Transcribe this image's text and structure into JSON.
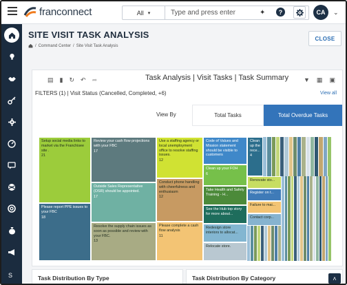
{
  "header": {
    "brand": "franconnect",
    "search": {
      "category": "All",
      "placeholder": "Type and press enter"
    },
    "user_initials": "CA"
  },
  "page": {
    "title": "SITE VISIT TASK ANALYSIS",
    "breadcrumbs": [
      "Command Center",
      "Site Visit Task Analysis"
    ],
    "close_label": "CLOSE"
  },
  "report": {
    "tabs": [
      "Task Analysis",
      "Visit Tasks",
      "Task Summary"
    ],
    "filters_label": "FILTERS (1)",
    "filter_name": "Visit Status",
    "filter_value": "(Cancelled, Completed, +6)",
    "view_all": "View all",
    "view_by": "View By",
    "toggle": [
      "Total Tasks",
      "Total Overdue Tasks"
    ],
    "active_toggle": "Total Overdue Tasks"
  },
  "treemap": {
    "tiles": [
      {
        "label": "Setup social media links to market via the Franchisee site .",
        "count": "21",
        "color": "#9ccc3b"
      },
      {
        "label": "Please report PPE issues to your FBC",
        "count": "18",
        "color": "#3c6d8a"
      },
      {
        "label": "Review your cash flow projections with your FBC",
        "count": "17",
        "color": "#5d7a7e"
      },
      {
        "label": "Outside Sales Representative (OSR) should be appointed.",
        "count": "17",
        "color": "#6fb1a3"
      },
      {
        "label": "Resolve the supply chain issues as soon as possible and review with your FBC.",
        "count": "13",
        "color": "#a8ab84"
      },
      {
        "label": "Use a staffing agency or local unemployment office to resolve staffing issues.",
        "count": "12",
        "color": "#d0e233"
      },
      {
        "label": "Conduct phone handling with cheerfulness and enthusiasm",
        "count": "12",
        "color": "#c79a62"
      },
      {
        "label": "Please complete a cash flow analysis",
        "count": "11",
        "color": "#f3c474"
      },
      {
        "label": "Code of Values and Mission statement should be visible to customers",
        "count": "",
        "color": "#3f88c9"
      },
      {
        "label": "Clean up your FOH",
        "count": "6",
        "color": "#76c04a"
      },
      {
        "label": "Take Health and Safety Training - H...",
        "count": "",
        "color": "#4c8a3a"
      },
      {
        "label": "See the Hub top story for more about...",
        "count": "",
        "color": "#1e6d5c"
      },
      {
        "label": "Redesign store interiors to allocat...",
        "count": "",
        "color": "#83b6d1"
      },
      {
        "label": "Relocate store.",
        "count": "",
        "color": "#b9c8d1"
      },
      {
        "label": "Clean up the rece...",
        "count": "4",
        "color": "#2c6e8c"
      },
      {
        "label": "Renovate sto...",
        "count": "",
        "color": "#c7dd62"
      },
      {
        "label": "Register on t...",
        "count": "",
        "color": "#3f7bb8"
      },
      {
        "label": "Failure to mai...",
        "count": "",
        "color": "#f3c474"
      },
      {
        "label": "Contact corp...",
        "count": "",
        "color": "#86b3cf"
      }
    ],
    "small_colors": [
      "#9bbfd8",
      "#5a8d9e",
      "#7a9a5a",
      "#c3d77a",
      "#3a5f7a",
      "#b0c9d8",
      "#e3c58a",
      "#6e8c6c",
      "#4e7fa6",
      "#a9b28c",
      "#d9e2ea",
      "#8fb7a0",
      "#2e5770",
      "#c2a66f",
      "#7fa6c4",
      "#98c46a"
    ]
  },
  "bottom": {
    "left_title": "Task Distribution By Type",
    "right_title": "Task Distribution By Category"
  }
}
